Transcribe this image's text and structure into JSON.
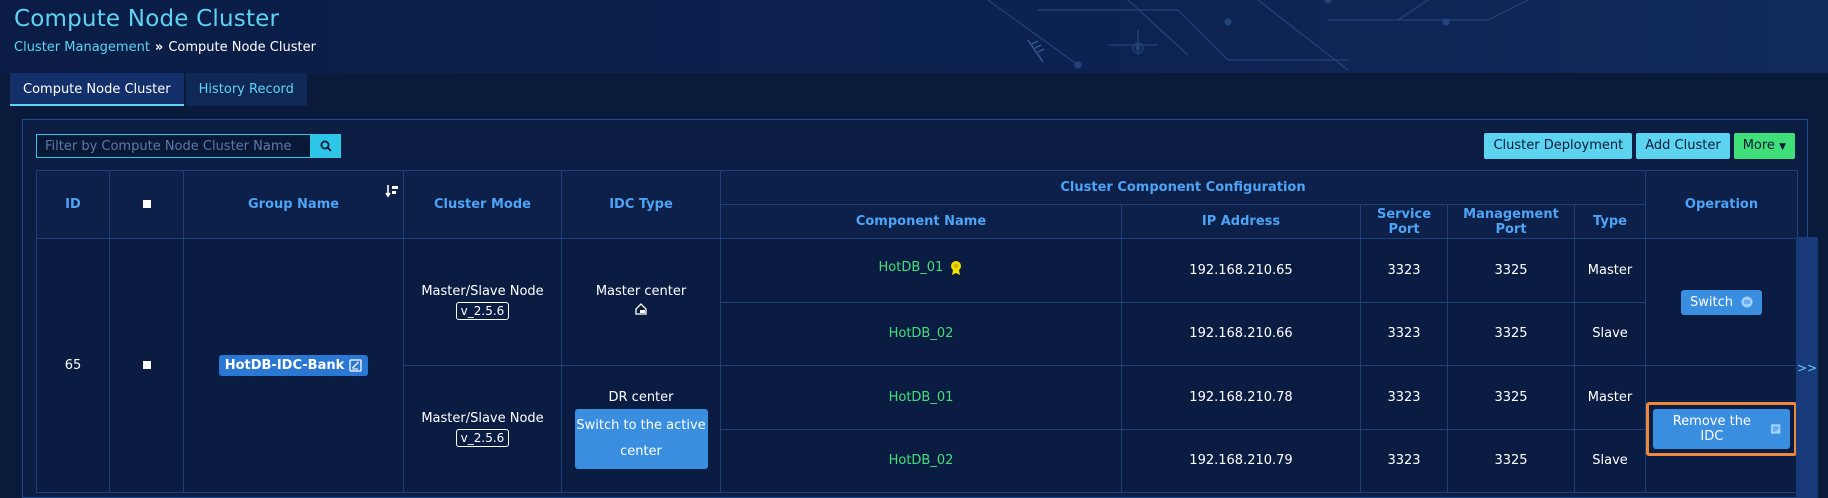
{
  "header": {
    "title": "Compute Node Cluster",
    "breadcrumb": {
      "parent": "Cluster Management",
      "separator": "»",
      "current": "Compute Node Cluster"
    }
  },
  "tabs": [
    {
      "label": "Compute Node Cluster",
      "active": true
    },
    {
      "label": "History Record",
      "active": false
    }
  ],
  "search": {
    "placeholder": "Filter by Compute Node Cluster Name",
    "value": ""
  },
  "actions": {
    "cluster_deployment": "Cluster Deployment",
    "add_cluster": "Add Cluster",
    "more": "More"
  },
  "table": {
    "headers": {
      "id": "ID",
      "group_name": "Group Name",
      "cluster_mode": "Cluster Mode",
      "idc_type": "IDC Type",
      "component_config": "Cluster Component Configuration",
      "component_name": "Component Name",
      "ip_address": "IP Address",
      "service_port": "Service Port",
      "management_port": "Management Port",
      "type": "Type",
      "operation": "Operation"
    },
    "row": {
      "id": "65",
      "group_name": "HotDB-IDC-Bank",
      "master_idc": {
        "cluster_mode": "Master/Slave Node",
        "version": "v_2.5.6",
        "idc_type": "Master center",
        "operation": "Switch",
        "components": [
          {
            "name": "HotDB_01",
            "ip": "192.168.210.65",
            "service_port": "3323",
            "management_port": "3325",
            "type": "Master"
          },
          {
            "name": "HotDB_02",
            "ip": "192.168.210.66",
            "service_port": "3323",
            "management_port": "3325",
            "type": "Slave"
          }
        ]
      },
      "dr_idc": {
        "cluster_mode": "Master/Slave Node",
        "version": "v_2.5.6",
        "idc_type": "DR center",
        "switch_center": "Switch to the active center",
        "operation": "Remove the IDC",
        "components": [
          {
            "name": "HotDB_01",
            "ip": "192.168.210.78",
            "service_port": "3323",
            "management_port": "3325",
            "type": "Master"
          },
          {
            "name": "HotDB_02",
            "ip": "192.168.210.79",
            "service_port": "3323",
            "management_port": "3325",
            "type": "Slave"
          }
        ]
      }
    }
  },
  "side_toggle": ">>",
  "colors": {
    "accent": "#5fd3f3",
    "header_text": "#4fa3f5",
    "green": "#3fe07a",
    "button_blue": "#3a8ee0",
    "highlight": "#f0883c"
  }
}
